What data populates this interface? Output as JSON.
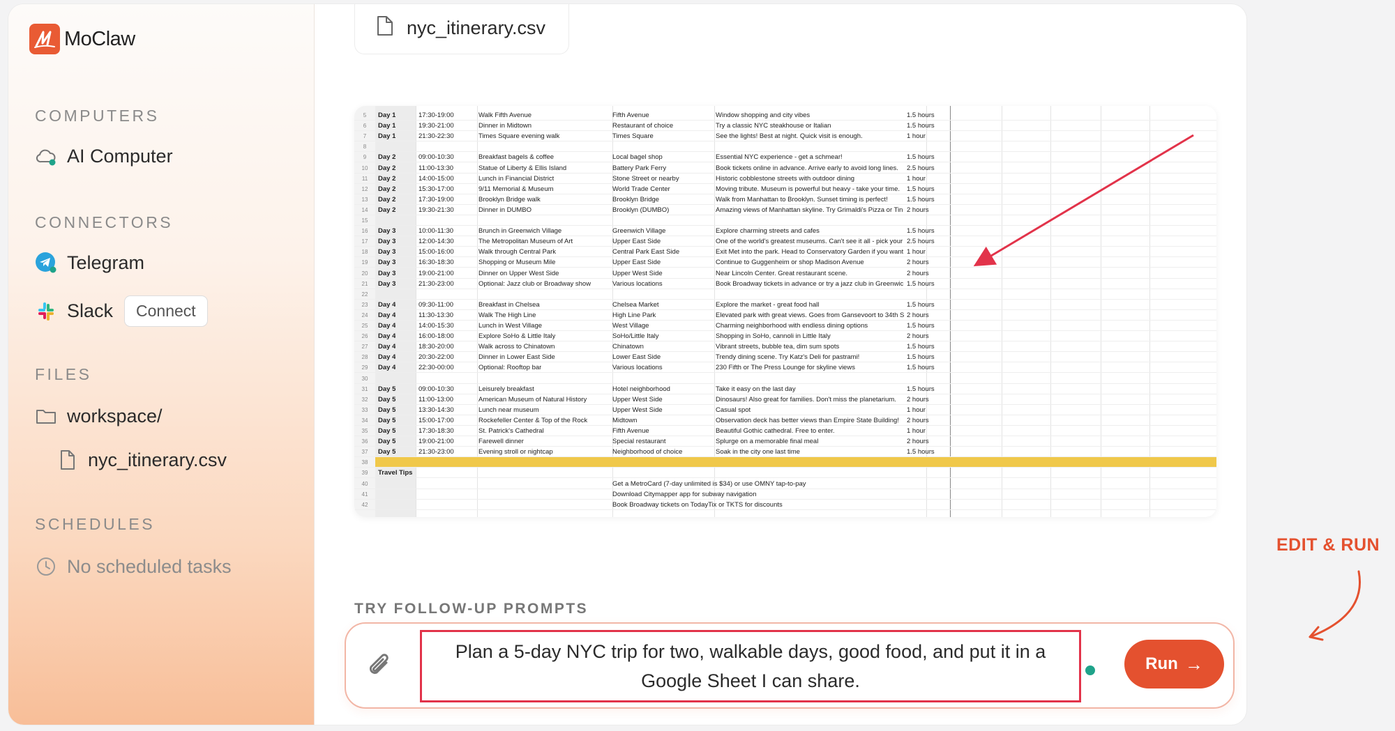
{
  "app": {
    "name": "MoClaw"
  },
  "sidebar": {
    "computers_heading": "COMPUTERS",
    "computer_item": "AI Computer",
    "connectors_heading": "CONNECTORS",
    "telegram_label": "Telegram",
    "slack_label": "Slack",
    "slack_connect_label": "Connect",
    "files_heading": "FILES",
    "folder_label": "workspace/",
    "file_label": "nyc_itinerary.csv",
    "schedules_heading": "SCHEDULES",
    "schedules_empty": "No scheduled tasks"
  },
  "main": {
    "open_file_tab": "nyc_itinerary.csv",
    "followup_heading": "TRY FOLLOW-UP PROMPTS",
    "prompt_text": "Plan a 5-day NYC trip for two, walkable days, good food, and put it in a Google Sheet I can share.",
    "run_label": "Run",
    "annotation": "EDIT & RUN"
  },
  "colors": {
    "accent": "#e4512f",
    "highlight_box": "#e2334a",
    "status_dot": "#1fa38a",
    "sheet_highlight": "#f0c84a"
  },
  "icons": [
    "moclaw-logo",
    "cloud-icon",
    "telegram-icon",
    "slack-icon",
    "folder-icon",
    "file-icon",
    "clock-icon",
    "paperclip-icon",
    "arrow-right-icon"
  ],
  "sheet_rows": [
    {
      "n": "5",
      "day": "Day 1",
      "time": "17:30-19:00",
      "activity": "Walk Fifth Avenue",
      "location": "Fifth Avenue",
      "notes": "Window shopping and city vibes",
      "duration": "1.5 hours"
    },
    {
      "n": "6",
      "day": "Day 1",
      "time": "19:30-21:00",
      "activity": "Dinner in Midtown",
      "location": "Restaurant of choice",
      "notes": "Try a classic NYC steakhouse or Italian",
      "duration": "1.5 hours"
    },
    {
      "n": "7",
      "day": "Day 1",
      "time": "21:30-22:30",
      "activity": "Times Square evening walk",
      "location": "Times Square",
      "notes": "See the lights! Best at night. Quick visit is enough.",
      "duration": "1 hour"
    },
    {
      "n": "8",
      "day": "",
      "time": "",
      "activity": "",
      "location": "",
      "notes": "",
      "duration": ""
    },
    {
      "n": "9",
      "day": "Day 2",
      "time": "09:00-10:30",
      "activity": "Breakfast bagels & coffee",
      "location": "Local bagel shop",
      "notes": "Essential NYC experience - get a schmear!",
      "duration": "1.5 hours"
    },
    {
      "n": "10",
      "day": "Day 2",
      "time": "11:00-13:30",
      "activity": "Statue of Liberty & Ellis Island",
      "location": "Battery Park Ferry",
      "notes": "Book tickets online in advance. Arrive early to avoid long lines.",
      "duration": "2.5 hours"
    },
    {
      "n": "11",
      "day": "Day 2",
      "time": "14:00-15:00",
      "activity": "Lunch in Financial District",
      "location": "Stone Street or nearby",
      "notes": "Historic cobblestone streets with outdoor dining",
      "duration": "1 hour"
    },
    {
      "n": "12",
      "day": "Day 2",
      "time": "15:30-17:00",
      "activity": "9/11 Memorial & Museum",
      "location": "World Trade Center",
      "notes": "Moving tribute. Museum is powerful but heavy - take your time.",
      "duration": "1.5 hours"
    },
    {
      "n": "13",
      "day": "Day 2",
      "time": "17:30-19:00",
      "activity": "Brooklyn Bridge walk",
      "location": "Brooklyn Bridge",
      "notes": "Walk from Manhattan to Brooklyn. Sunset timing is perfect!",
      "duration": "1.5 hours"
    },
    {
      "n": "14",
      "day": "Day 2",
      "time": "19:30-21:30",
      "activity": "Dinner in DUMBO",
      "location": "Brooklyn (DUMBO)",
      "notes": "Amazing views of Manhattan skyline. Try Grimaldi's Pizza or Tin",
      "duration": "2 hours"
    },
    {
      "n": "15",
      "day": "",
      "time": "",
      "activity": "",
      "location": "",
      "notes": "",
      "duration": ""
    },
    {
      "n": "16",
      "day": "Day 3",
      "time": "10:00-11:30",
      "activity": "Brunch in Greenwich Village",
      "location": "Greenwich Village",
      "notes": "Explore charming streets and cafes",
      "duration": "1.5 hours"
    },
    {
      "n": "17",
      "day": "Day 3",
      "time": "12:00-14:30",
      "activity": "The Metropolitan Museum of Art",
      "location": "Upper East Side",
      "notes": "One of the world's greatest museums. Can't see it all - pick your",
      "duration": "2.5 hours"
    },
    {
      "n": "18",
      "day": "Day 3",
      "time": "15:00-16:00",
      "activity": "Walk through Central Park",
      "location": "Central Park East Side",
      "notes": "Exit Met into the park. Head to Conservatory Garden if you want",
      "duration": "1 hour"
    },
    {
      "n": "19",
      "day": "Day 3",
      "time": "16:30-18:30",
      "activity": "Shopping or Museum Mile",
      "location": "Upper East Side",
      "notes": "Continue to Guggenheim or shop Madison Avenue",
      "duration": "2 hours"
    },
    {
      "n": "20",
      "day": "Day 3",
      "time": "19:00-21:00",
      "activity": "Dinner on Upper West Side",
      "location": "Upper West Side",
      "notes": "Near Lincoln Center. Great restaurant scene.",
      "duration": "2 hours"
    },
    {
      "n": "21",
      "day": "Day 3",
      "time": "21:30-23:00",
      "activity": "Optional: Jazz club or Broadway show",
      "location": "Various locations",
      "notes": "Book Broadway tickets in advance or try a jazz club in Greenwic",
      "duration": "1.5 hours"
    },
    {
      "n": "22",
      "day": "",
      "time": "",
      "activity": "",
      "location": "",
      "notes": "",
      "duration": ""
    },
    {
      "n": "23",
      "day": "Day 4",
      "time": "09:30-11:00",
      "activity": "Breakfast in Chelsea",
      "location": "Chelsea Market",
      "notes": "Explore the market - great food hall",
      "duration": "1.5 hours"
    },
    {
      "n": "24",
      "day": "Day 4",
      "time": "11:30-13:30",
      "activity": "Walk The High Line",
      "location": "High Line Park",
      "notes": "Elevated park with great views. Goes from Gansevoort to 34th S",
      "duration": "2 hours"
    },
    {
      "n": "25",
      "day": "Day 4",
      "time": "14:00-15:30",
      "activity": "Lunch in West Village",
      "location": "West Village",
      "notes": "Charming neighborhood with endless dining options",
      "duration": "1.5 hours"
    },
    {
      "n": "26",
      "day": "Day 4",
      "time": "16:00-18:00",
      "activity": "Explore SoHo & Little Italy",
      "location": "SoHo/Little Italy",
      "notes": "Shopping in SoHo, cannoli in Little Italy",
      "duration": "2 hours"
    },
    {
      "n": "27",
      "day": "Day 4",
      "time": "18:30-20:00",
      "activity": "Walk across to Chinatown",
      "location": "Chinatown",
      "notes": "Vibrant streets, bubble tea, dim sum spots",
      "duration": "1.5 hours"
    },
    {
      "n": "28",
      "day": "Day 4",
      "time": "20:30-22:00",
      "activity": "Dinner in Lower East Side",
      "location": "Lower East Side",
      "notes": "Trendy dining scene. Try Katz's Deli for pastrami!",
      "duration": "1.5 hours"
    },
    {
      "n": "29",
      "day": "Day 4",
      "time": "22:30-00:00",
      "activity": "Optional: Rooftop bar",
      "location": "Various locations",
      "notes": "230 Fifth or The Press Lounge for skyline views",
      "duration": "1.5 hours"
    },
    {
      "n": "30",
      "day": "",
      "time": "",
      "activity": "",
      "location": "",
      "notes": "",
      "duration": ""
    },
    {
      "n": "31",
      "day": "Day 5",
      "time": "09:00-10:30",
      "activity": "Leisurely breakfast",
      "location": "Hotel neighborhood",
      "notes": "Take it easy on the last day",
      "duration": "1.5 hours"
    },
    {
      "n": "32",
      "day": "Day 5",
      "time": "11:00-13:00",
      "activity": "American Museum of Natural History",
      "location": "Upper West Side",
      "notes": "Dinosaurs! Also great for families. Don't miss the planetarium.",
      "duration": "2 hours"
    },
    {
      "n": "33",
      "day": "Day 5",
      "time": "13:30-14:30",
      "activity": "Lunch near museum",
      "location": "Upper West Side",
      "notes": "Casual spot",
      "duration": "1 hour"
    },
    {
      "n": "34",
      "day": "Day 5",
      "time": "15:00-17:00",
      "activity": "Rockefeller Center & Top of the Rock",
      "location": "Midtown",
      "notes": "Observation deck has better views than Empire State Building!",
      "duration": "2 hours"
    },
    {
      "n": "35",
      "day": "Day 5",
      "time": "17:30-18:30",
      "activity": "St. Patrick's Cathedral",
      "location": "Fifth Avenue",
      "notes": "Beautiful Gothic cathedral. Free to enter.",
      "duration": "1 hour"
    },
    {
      "n": "36",
      "day": "Day 5",
      "time": "19:00-21:00",
      "activity": "Farewell dinner",
      "location": "Special restaurant",
      "notes": "Splurge on a memorable final meal",
      "duration": "2 hours"
    },
    {
      "n": "37",
      "day": "Day 5",
      "time": "21:30-23:00",
      "activity": "Evening stroll or nightcap",
      "location": "Neighborhood of choice",
      "notes": "Soak in the city one last time",
      "duration": "1.5 hours"
    },
    {
      "n": "38",
      "day": "",
      "time": "",
      "activity": "",
      "location": "",
      "notes": "",
      "duration": ""
    },
    {
      "n": "39",
      "day": "Travel Tips",
      "time": "",
      "activity": "",
      "location": "",
      "notes": "",
      "duration": ""
    },
    {
      "n": "40",
      "day": "",
      "time": "",
      "activity": "",
      "location": "Get a MetroCard (7-day unlimited is $34) or use OMNY tap-to-pay",
      "notes": "",
      "duration": ""
    },
    {
      "n": "41",
      "day": "",
      "time": "",
      "activity": "",
      "location": "Download Citymapper app for subway navigation",
      "notes": "",
      "duration": ""
    },
    {
      "n": "42",
      "day": "",
      "time": "",
      "activity": "",
      "location": "Book Broadway tickets on TodayTix or TKTS for discounts",
      "notes": "",
      "duration": ""
    }
  ]
}
